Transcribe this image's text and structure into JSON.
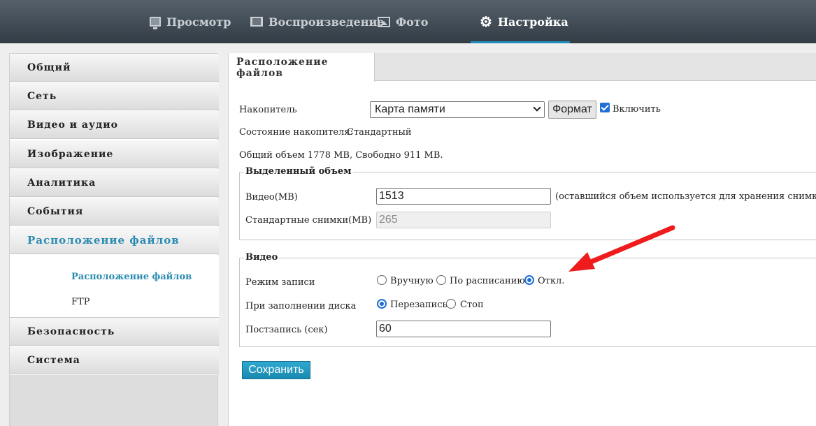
{
  "nav": {
    "items": [
      {
        "label": "Просмотр",
        "icon": "monitor-icon"
      },
      {
        "label": "Воспроизведение",
        "icon": "film-icon"
      },
      {
        "label": "Фото",
        "icon": "photo-icon"
      },
      {
        "label": "Настройка",
        "icon": "gear-icon"
      }
    ],
    "active": "Настройка",
    "accent_color": "#1e8cb8"
  },
  "sidebar": {
    "items": [
      {
        "label": "Общий"
      },
      {
        "label": "Сеть"
      },
      {
        "label": "Видео и аудио"
      },
      {
        "label": "Изображение"
      },
      {
        "label": "Аналитика"
      },
      {
        "label": "События"
      },
      {
        "label": "Расположение файлов"
      },
      {
        "label": "Безопасность"
      },
      {
        "label": "Система"
      }
    ],
    "active": "Расположение файлов",
    "sub_items": [
      {
        "label": "Расположение файлов"
      },
      {
        "label": "FTP"
      }
    ],
    "active_color": "#2a8bb2"
  },
  "main": {
    "tab_label": "Расположение файлов",
    "storage": {
      "label": "Накопитель",
      "selected": "Карта памяти",
      "format_button": "Формат",
      "enable_label": "Включить",
      "enabled": true
    },
    "status": {
      "label": "Состояние накопителя:",
      "value": "Стандартный"
    },
    "capacity_text": "Общий объем  1778  MB,  Свободно  911  MB.",
    "allocated": {
      "legend": "Выделенный объем",
      "video_label": "Видео(MB)",
      "video_value": "1513",
      "video_note": "(оставшийся объем используется для хранения снимков)",
      "snapshots_label": "Стандартные снимки(MB)",
      "snapshots_value": "265"
    },
    "video": {
      "legend": "Видео",
      "record_mode_label": "Режим записи",
      "record_modes": [
        "Вручную",
        "По расписанию",
        "Откл."
      ],
      "record_mode_selected": "Откл.",
      "disk_full_label": "При заполнении диска",
      "disk_full_options": [
        "Перезапись",
        "Стоп"
      ],
      "disk_full_selected": "Перезапись",
      "post_record_label": "Постзапись (сек)",
      "post_record_value": "60"
    },
    "save_button": "Сохранить"
  },
  "annotation": {
    "color": "#ee1c1c",
    "icon": "red-arrow-annotation"
  }
}
